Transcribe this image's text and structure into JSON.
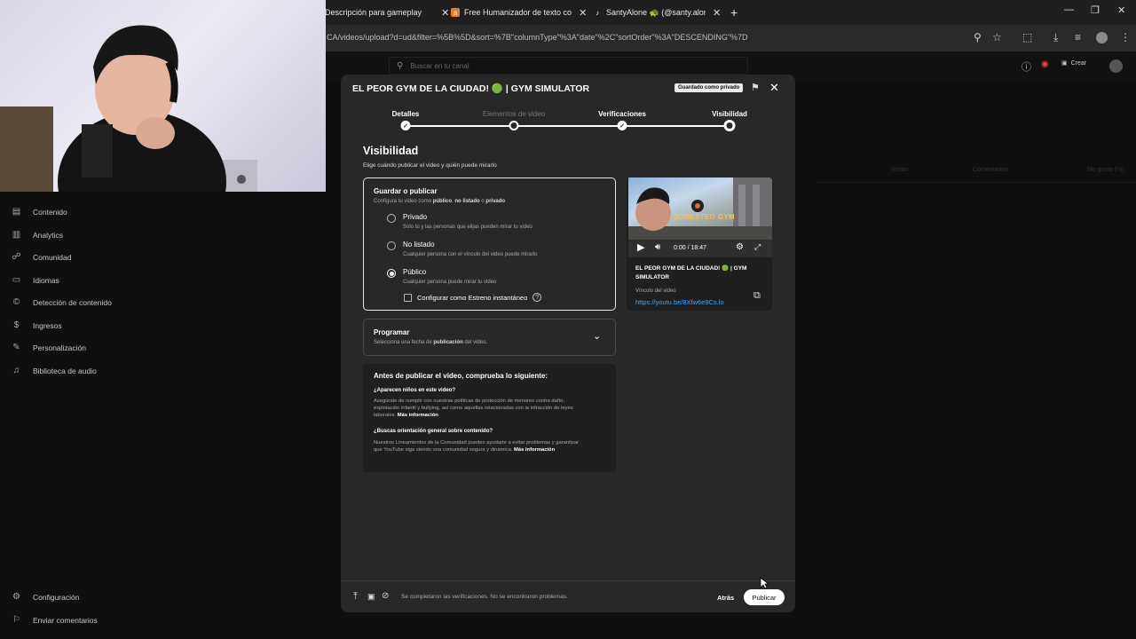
{
  "browser": {
    "tabs": [
      {
        "label": "Descripción para gameplay"
      },
      {
        "label": "Free Humanizador de texto co"
      },
      {
        "label": "SantyAlone 🐢 (@santy.aloneok"
      }
    ],
    "url": "CA/videos/upload?d=ud&filter=%5B%5D&sort=%7B\"columnType\"%3A\"date\"%2C\"sortOrder\"%3A\"DESCENDING\"%7D"
  },
  "studio": {
    "search_placeholder": "Buscar en tu canal",
    "create_label": "Crear",
    "sidebar": [
      {
        "label": "Contenido",
        "icon": "content-icon"
      },
      {
        "label": "Analytics",
        "icon": "analytics-icon"
      },
      {
        "label": "Comunidad",
        "icon": "community-icon"
      },
      {
        "label": "Idiomas",
        "icon": "subtitles-icon"
      },
      {
        "label": "Detección de contenido",
        "icon": "copyright-icon"
      },
      {
        "label": "Ingresos",
        "icon": "dollar-icon"
      },
      {
        "label": "Personalización",
        "icon": "wand-icon"
      },
      {
        "label": "Biblioteca de audio",
        "icon": "audio-library-icon"
      }
    ],
    "bottom_items": [
      {
        "label": "Configuración",
        "icon": "gear-icon"
      },
      {
        "label": "Enviar comentarios",
        "icon": "feedback-icon"
      }
    ],
    "bg_columns": [
      "Vistas",
      "Comentarios",
      "Me gusta (%)"
    ]
  },
  "dialog": {
    "title": "EL PEOR GYM DE LA CIUDAD! 🟢 | GYM SIMULATOR",
    "saved_badge": "Guardado como privado",
    "steps": [
      {
        "label": "Detalles",
        "state": "done"
      },
      {
        "label": "Elementos de video",
        "state": "dim"
      },
      {
        "label": "Verificaciones",
        "state": "done"
      },
      {
        "label": "Visibilidad",
        "state": "current"
      }
    ],
    "section_title": "Visibilidad",
    "section_subtitle": "Elige cuándo publicar el video y quién puede mirarlo",
    "save": {
      "title": "Guardar o publicar",
      "subtitle_a": "Configura tu video como ",
      "subtitle_b": "público",
      "subtitle_c": ", ",
      "subtitle_d": "no listado",
      "subtitle_e": " o ",
      "subtitle_f": "privado",
      "options": [
        {
          "label": "Privado",
          "desc": "Solo tú y las personas que elijas pueden mirar tu video",
          "selected": false
        },
        {
          "label": "No listado",
          "desc": "Cualquier persona con el vínculo del video puede mirarlo",
          "selected": false
        },
        {
          "label": "Público",
          "desc": "Cualquier persona puede mirar tu video",
          "selected": true
        }
      ],
      "premiere_label": "Configurar como Estreno instantáneo"
    },
    "schedule": {
      "title": "Programar",
      "subtitle_a": "Selecciona una fecha de ",
      "subtitle_b": "publicación",
      "subtitle_c": " del video."
    },
    "checklist": {
      "title": "Antes de publicar el video, comprueba lo siguiente:",
      "q1": "¿Aparecen niños en este video?",
      "a1": "Asegúrate de cumplir con nuestras políticas de protección de menores contra daño, explotación infantil y bullying, así como aquellas relacionadas con la infracción de leyes laborales.",
      "a1_link": "Más información",
      "q2": "¿Buscas orientación general sobre contenido?",
      "a2": "Nuestros Lineamientos de la Comunidad pueden ayudarte a evitar problemas y garantizar que YouTube siga siendo una comunidad segura y dinámica.",
      "a2_link": "Más información"
    },
    "preview": {
      "time": "0:00 / 18:47",
      "overlay_text": "DOMESTEO GYM",
      "title": "EL PEOR GYM DE LA CIUDAD! 🟢 | GYM SIMULATOR",
      "link_label": "Vínculo del video",
      "link": "https://youtu.be/8Xfw6e9Cs.lo"
    },
    "footer_status": "Se completaron las verificaciones. No se encontraron problemas.",
    "back_label": "Atrás",
    "publish_label": "Publicar"
  },
  "colors": {
    "link": "#3ea6ff",
    "accent_check": "#ffffff"
  }
}
